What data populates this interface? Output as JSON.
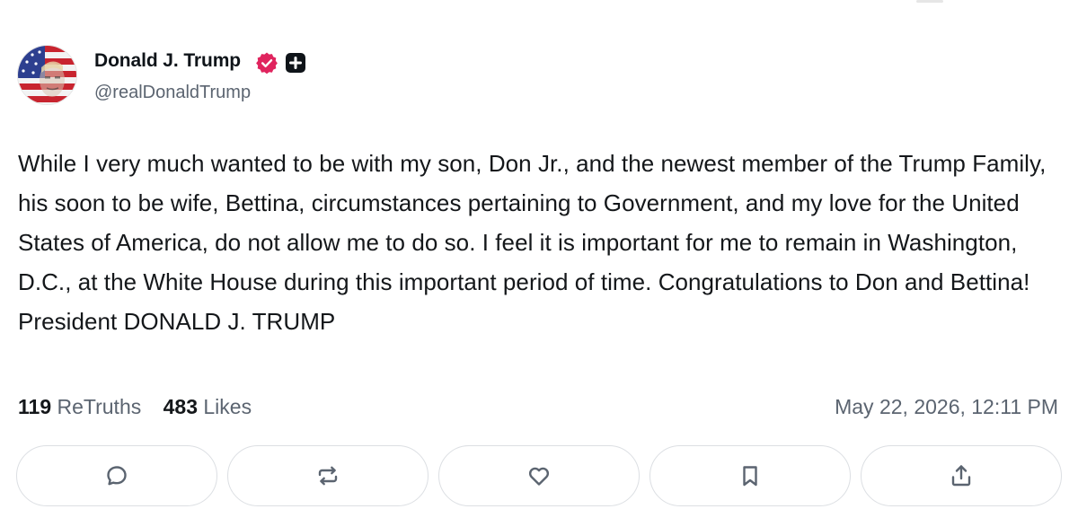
{
  "post": {
    "author_name": "Donald J. Trump",
    "handle": "@realDonaldTrump",
    "text": "While I very much wanted to be with my son, Don Jr., and the newest member of the Trump Family, his soon to be wife, Bettina, circumstances pertaining to Government, and my love for the United States of America, do not allow me to do so. I feel it is important for me to remain in Washington, D.C., at the White House during this important period of time. Congratulations to Don and Bettina! President DONALD J. TRUMP",
    "retruths_count": "119",
    "retruths_label": "ReTruths",
    "likes_count": "483",
    "likes_label": "Likes",
    "timestamp": "May 22, 2026, 12:11 PM"
  },
  "colors": {
    "verified_badge": "#e0245e",
    "text_primary": "#14171a",
    "text_secondary": "#5b6470",
    "button_border": "#dcdfe3"
  },
  "icons": {
    "verified": "verified-badge-icon",
    "plus": "plus-square-icon",
    "reply": "speech-bubble-icon",
    "retruth": "repost-arrows-icon",
    "like": "heart-icon",
    "bookmark": "bookmark-icon",
    "share": "share-upload-icon"
  }
}
